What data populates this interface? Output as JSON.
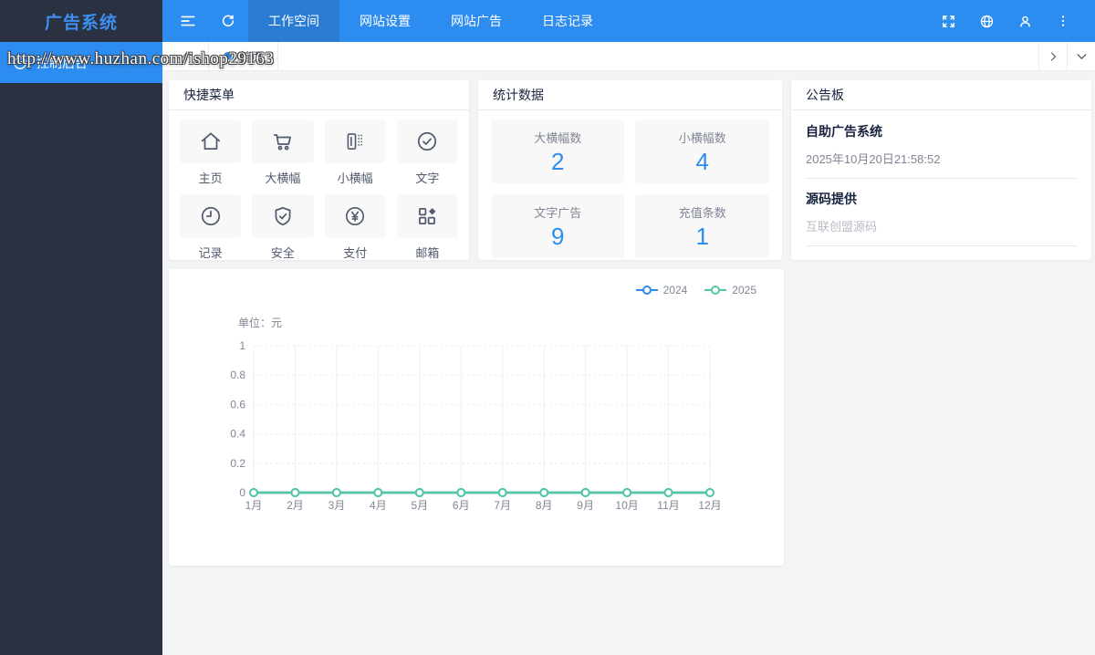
{
  "app": {
    "title": "广告系统"
  },
  "sidebar": {
    "console": {
      "label": "控制后台",
      "icon": "gauge-icon"
    }
  },
  "topnav": {
    "items": [
      {
        "label": "工作空间",
        "active": true
      },
      {
        "label": "网站设置",
        "active": false
      },
      {
        "label": "网站广告",
        "active": false
      },
      {
        "label": "日志记录",
        "active": false
      }
    ],
    "right_icons": [
      "fullscreen-icon",
      "globe-icon",
      "user-icon",
      "kebab-menu-icon"
    ]
  },
  "tabbar": {
    "tabs": [
      {
        "label": "首页",
        "active": true
      }
    ]
  },
  "watermark": {
    "text": "http://www.huzhan.com/ishop29163"
  },
  "cards": {
    "quick_menu": {
      "title": "快捷菜单",
      "items": [
        {
          "label": "主页",
          "icon": "home-icon"
        },
        {
          "label": "大横幅",
          "icon": "cart-icon"
        },
        {
          "label": "小横幅",
          "icon": "banner-icon"
        },
        {
          "label": "文字",
          "icon": "check-circle-icon"
        },
        {
          "label": "记录",
          "icon": "clock-icon"
        },
        {
          "label": "安全",
          "icon": "shield-check-icon"
        },
        {
          "label": "支付",
          "icon": "yuan-circle-icon"
        },
        {
          "label": "邮箱",
          "icon": "grid-diamond-icon"
        }
      ]
    },
    "stats": {
      "title": "统计数据",
      "accent_color": "#2d8cf0",
      "items": [
        {
          "label": "大横幅数",
          "value": "2"
        },
        {
          "label": "小横幅数",
          "value": "4"
        },
        {
          "label": "文字广告",
          "value": "9"
        },
        {
          "label": "充值条数",
          "value": "1"
        }
      ]
    },
    "notice": {
      "title": "公告板",
      "sections": [
        {
          "title": "自助广告系统",
          "text": "2025年10月20日21:58:52"
        },
        {
          "title": "源码提供",
          "text": "互联创盟源码"
        }
      ]
    }
  },
  "chart_data": {
    "type": "line",
    "unit_label": "单位：元",
    "categories": [
      "1月",
      "2月",
      "3月",
      "4月",
      "5月",
      "6月",
      "7月",
      "8月",
      "9月",
      "10月",
      "11月",
      "12月"
    ],
    "series": [
      {
        "name": "2024",
        "color": "#2d8cf0",
        "values": [
          0,
          0,
          0,
          0,
          0,
          0,
          0,
          0,
          0,
          0,
          0,
          0
        ]
      },
      {
        "name": "2025",
        "color": "#54c7a0",
        "values": [
          0,
          0,
          0,
          0,
          0,
          0,
          0,
          0,
          0,
          0,
          0,
          0
        ]
      }
    ],
    "ylim": [
      0,
      1
    ],
    "yticks": [
      0,
      0.2,
      0.4,
      0.6,
      0.8,
      1
    ],
    "grid": true,
    "legend_position": "top-right"
  }
}
